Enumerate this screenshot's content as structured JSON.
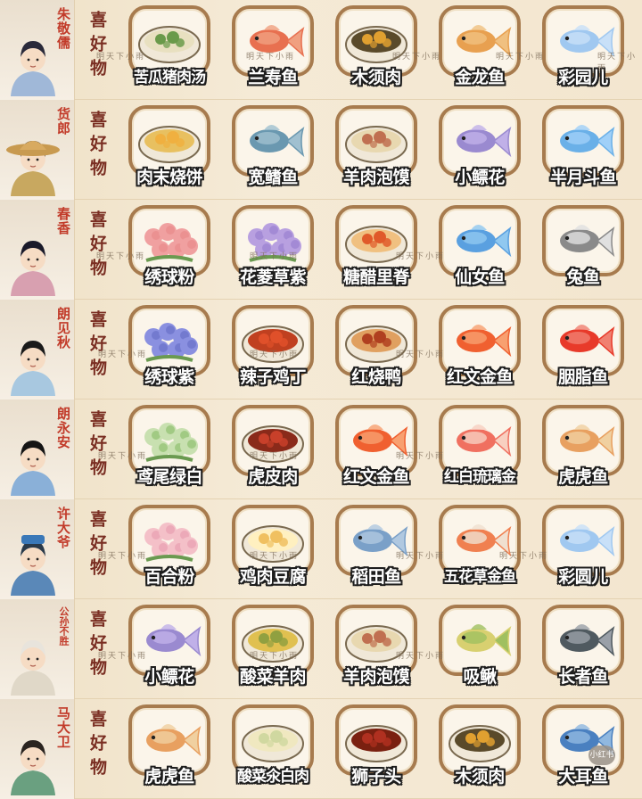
{
  "fav_label": "喜好物",
  "watermark": "明天下小雨",
  "badge": "小红书",
  "rows": [
    {
      "name": "朱敬儒",
      "items": [
        {
          "label": "苦瓜猪肉汤",
          "icon": "bitter-melon-soup-icon"
        },
        {
          "label": "兰寿鱼",
          "icon": "ranchu-fish-icon"
        },
        {
          "label": "木须肉",
          "icon": "muxu-pork-icon"
        },
        {
          "label": "金龙鱼",
          "icon": "golden-arowana-icon"
        },
        {
          "label": "彩园儿",
          "icon": "ornamental-fish-icon"
        }
      ]
    },
    {
      "name": "货郎",
      "items": [
        {
          "label": "肉末烧饼",
          "icon": "meat-flatbread-icon"
        },
        {
          "label": "宽鳍鱼",
          "icon": "wide-fin-fish-icon"
        },
        {
          "label": "羊肉泡馍",
          "icon": "mutton-bread-soup-icon"
        },
        {
          "label": "小鳔花",
          "icon": "small-fish-icon"
        },
        {
          "label": "半月斗鱼",
          "icon": "halfmoon-betta-icon"
        }
      ]
    },
    {
      "name": "春香",
      "items": [
        {
          "label": "绣球粉",
          "icon": "pink-hydrangea-icon"
        },
        {
          "label": "花菱草紫",
          "icon": "purple-poppy-icon"
        },
        {
          "label": "糖醋里脊",
          "icon": "sweet-sour-pork-icon"
        },
        {
          "label": "仙女鱼",
          "icon": "fairy-fish-icon"
        },
        {
          "label": "兔鱼",
          "icon": "rabbit-fish-icon"
        }
      ]
    },
    {
      "name": "朗见秋",
      "items": [
        {
          "label": "绣球紫",
          "icon": "purple-hydrangea-icon"
        },
        {
          "label": "辣子鸡丁",
          "icon": "spicy-chicken-icon"
        },
        {
          "label": "红烧鸭",
          "icon": "braised-duck-icon"
        },
        {
          "label": "红文金鱼",
          "icon": "red-goldfish-icon"
        },
        {
          "label": "胭脂鱼",
          "icon": "rouge-fish-icon"
        }
      ]
    },
    {
      "name": "朗永安",
      "items": [
        {
          "label": "鸢尾绿白",
          "icon": "iris-flower-icon"
        },
        {
          "label": "虎皮肉",
          "icon": "tiger-skin-pork-icon"
        },
        {
          "label": "红文金鱼",
          "icon": "red-goldfish-icon"
        },
        {
          "label": "红白琉璃金",
          "icon": "red-white-goldfish-icon"
        },
        {
          "label": "虎虎鱼",
          "icon": "tiger-fish-icon"
        }
      ]
    },
    {
      "name": "许大爷",
      "items": [
        {
          "label": "百合粉",
          "icon": "pink-lily-icon"
        },
        {
          "label": "鸡肉豆腐",
          "icon": "chicken-tofu-icon"
        },
        {
          "label": "稻田鱼",
          "icon": "paddy-fish-icon"
        },
        {
          "label": "五花草金鱼",
          "icon": "calico-goldfish-icon"
        },
        {
          "label": "彩圆儿",
          "icon": "ornamental-fish-icon"
        }
      ]
    },
    {
      "name": "公孙不胜",
      "items": [
        {
          "label": "小鳔花",
          "icon": "small-fish-icon"
        },
        {
          "label": "酸菜羊肉",
          "icon": "pickled-mutton-icon"
        },
        {
          "label": "羊肉泡馍",
          "icon": "mutton-bread-soup-icon"
        },
        {
          "label": "吸鳅",
          "icon": "loach-fish-icon"
        },
        {
          "label": "长者鱼",
          "icon": "elder-fish-icon"
        }
      ]
    },
    {
      "name": "马大卫",
      "items": [
        {
          "label": "虎虎鱼",
          "icon": "tiger-fish-icon"
        },
        {
          "label": "酸菜氽白肉",
          "icon": "pickled-pork-icon"
        },
        {
          "label": "狮子头",
          "icon": "lions-head-meatball-icon"
        },
        {
          "label": "木须肉",
          "icon": "muxu-pork-icon"
        },
        {
          "label": "大耳鱼",
          "icon": "big-ear-fish-icon"
        }
      ]
    }
  ],
  "colors": {
    "card_border": "#a77b4e",
    "name_red": "#c23b2a",
    "fav_brown": "#7a2e22",
    "background": "#f3e6cf"
  }
}
